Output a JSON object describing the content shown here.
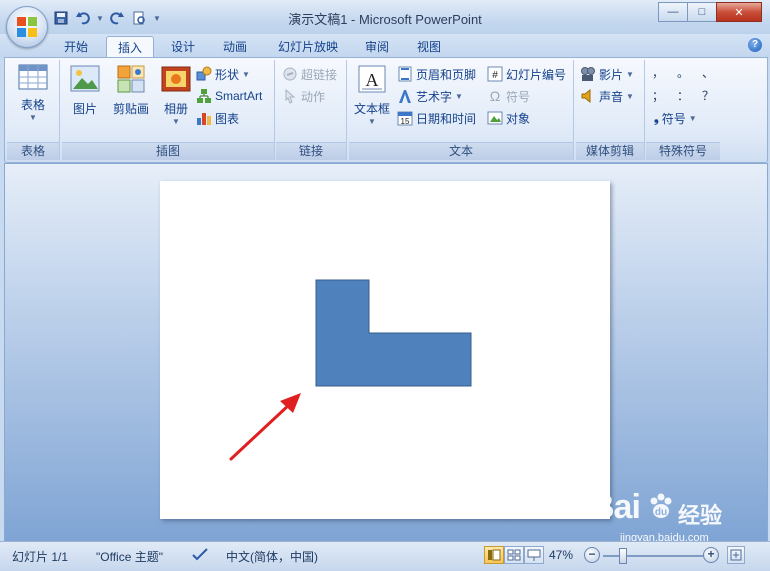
{
  "window": {
    "title": "演示文稿1 - Microsoft PowerPoint",
    "minimize": "—",
    "maximize": "□",
    "close": "✕"
  },
  "qat": {
    "icons": [
      "save-icon",
      "undo-icon",
      "redo-icon",
      "print-preview-icon",
      "customize-icon"
    ]
  },
  "tabs": [
    {
      "label": "开始"
    },
    {
      "label": "插入"
    },
    {
      "label": "设计"
    },
    {
      "label": "动画"
    },
    {
      "label": "幻灯片放映"
    },
    {
      "label": "审阅"
    },
    {
      "label": "视图"
    }
  ],
  "active_tab": "插入",
  "help": "?",
  "ribbon": {
    "tables": {
      "label": "表格",
      "table_button": "表格"
    },
    "illustrations": {
      "label": "插图",
      "picture": "图片",
      "clipart": "剪贴画",
      "album": "相册",
      "shapes": "形状",
      "smartart": "SmartArt",
      "chart": "图表"
    },
    "links": {
      "label": "链接",
      "hyperlink": "超链接",
      "action": "动作"
    },
    "text": {
      "label": "文本",
      "textbox": "文本框",
      "header_footer": "页眉和页脚",
      "wordart": "艺术字",
      "datetime": "日期和时间",
      "slide_number": "幻灯片编号",
      "symbol": "符号",
      "object": "对象"
    },
    "media": {
      "label": "媒体剪辑",
      "movie": "影片",
      "sound": "声音"
    },
    "special": {
      "label": "特殊符号",
      "row1": [
        "，",
        "。",
        "、"
      ],
      "row2": [
        "；",
        "：",
        "？"
      ],
      "bullet": "❟",
      "symbol": "符号"
    }
  },
  "colors": {
    "shape_fill": "#4f81bd",
    "shape_stroke": "#385d8a",
    "arrow": "#e02020"
  },
  "status": {
    "slide": "幻灯片 1/1",
    "theme": "\"Office 主题\"",
    "language": "中文(简体，中国)",
    "zoom": "47%",
    "zoom_minus": "−",
    "zoom_plus": "+"
  },
  "watermark": {
    "brand": "Bai",
    "brand_cn": "经验",
    "url": "jingyan.baidu.com"
  }
}
